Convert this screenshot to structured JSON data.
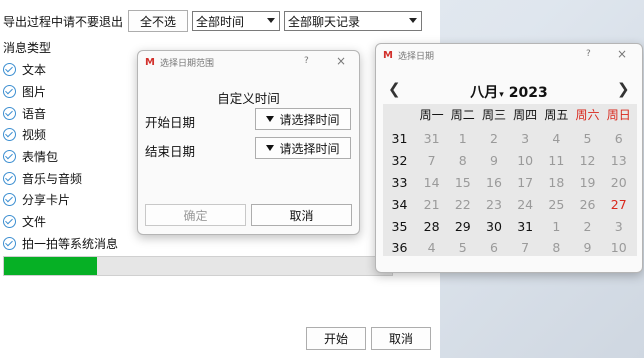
{
  "main": {
    "prompt_text": "导出过程中请不要退出",
    "deselect_all_label": "全不选",
    "time_select_value": "全部时间",
    "chat_select_value": "全部聊天记录",
    "category_title": "消息类型",
    "categories": [
      "文本",
      "图片",
      "语音",
      "视频",
      "表情包",
      "音乐与音频",
      "分享卡片",
      "文件",
      "拍一拍等系统消息"
    ],
    "progress_fraction": 0.24,
    "start_label": "开始",
    "cancel_label": "取消"
  },
  "range_dialog": {
    "title": "选择日期范围",
    "help": "?",
    "close": "×",
    "heading": "自定义时间",
    "start_label": "开始日期",
    "end_label": "结束日期",
    "choose_time_label": "请选择时间",
    "ok_label": "确定",
    "cancel_label": "取消"
  },
  "calendar_dialog": {
    "title": "选择日期",
    "help": "?",
    "close": "×",
    "month_label": "八月",
    "year_label": "2023",
    "prev_label": "❮",
    "next_label": "❯",
    "weekday_headers": [
      "周一",
      "周二",
      "周三",
      "周四",
      "周五",
      "周六",
      "周日"
    ],
    "weeks": [
      {
        "week": "31",
        "days": [
          "31",
          "1",
          "2",
          "3",
          "4",
          "5",
          "6"
        ]
      },
      {
        "week": "32",
        "days": [
          "7",
          "8",
          "9",
          "10",
          "11",
          "12",
          "13"
        ]
      },
      {
        "week": "33",
        "days": [
          "14",
          "15",
          "16",
          "17",
          "18",
          "19",
          "20"
        ]
      },
      {
        "week": "34",
        "days": [
          "21",
          "22",
          "23",
          "24",
          "25",
          "26",
          "27"
        ]
      },
      {
        "week": "35",
        "days": [
          "28",
          "29",
          "30",
          "31",
          "1",
          "2",
          "3"
        ]
      },
      {
        "week": "36",
        "days": [
          "4",
          "5",
          "6",
          "7",
          "8",
          "9",
          "10"
        ]
      }
    ],
    "colors": {
      "weekend": "#d9281d",
      "inactive": "#9a9a9a",
      "active": "#111111",
      "grid_bg": "#e8e8e8"
    }
  }
}
